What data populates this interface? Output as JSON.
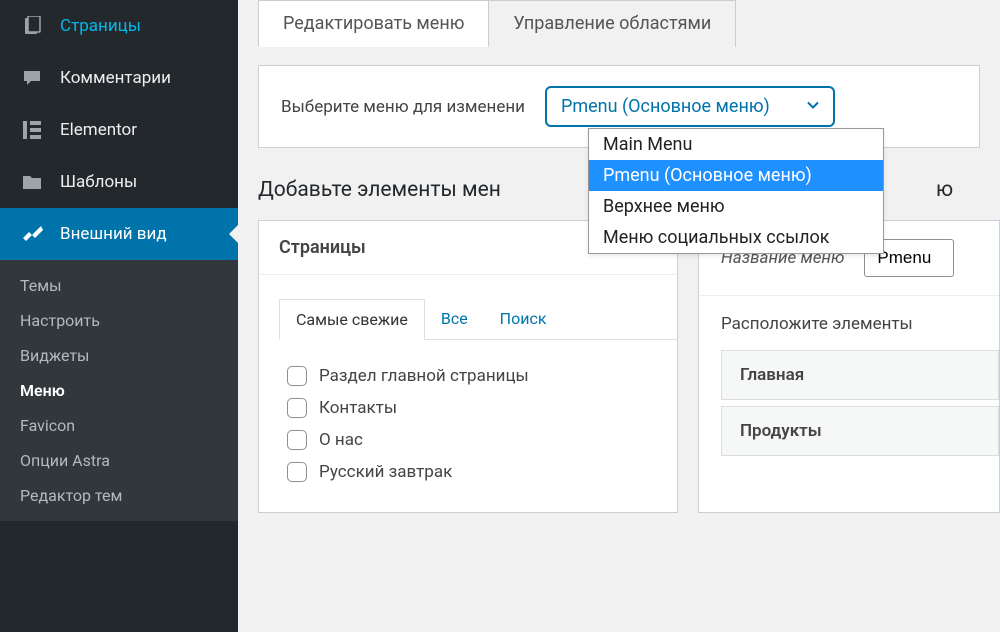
{
  "sidebar": {
    "items": [
      {
        "label": "Страницы",
        "icon": "pages"
      },
      {
        "label": "Комментарии",
        "icon": "comments"
      },
      {
        "label": "Elementor",
        "icon": "elementor"
      },
      {
        "label": "Шаблоны",
        "icon": "templates"
      },
      {
        "label": "Внешний вид",
        "icon": "appearance"
      }
    ],
    "submenu": [
      "Темы",
      "Настроить",
      "Виджеты",
      "Меню",
      "Favicon",
      "Опции Astra",
      "Редактор тем"
    ]
  },
  "tabs": {
    "edit": "Редактировать меню",
    "manage": "Управление областями"
  },
  "selector": {
    "label": "Выберите меню для изменени",
    "selected": "Pmenu (Основное меню)",
    "options": [
      "Main Menu",
      "Pmenu (Основное меню)",
      "Верхнее меню",
      "Меню социальных ссылок"
    ]
  },
  "add_heading": "Добавьте элементы мен",
  "structure_heading_tail": "ю",
  "pages_panel": {
    "title": "Страницы",
    "tabs": {
      "recent": "Самые свежие",
      "all": "Все",
      "search": "Поиск"
    },
    "items": [
      "Раздел главной страницы",
      "Контакты",
      "О нас",
      "Русский завтрак"
    ]
  },
  "menu_name": {
    "label": "Название меню",
    "value": "Pmenu"
  },
  "arrange_hint": "Расположите элементы",
  "menu_items": [
    "Главная",
    "Продукты"
  ]
}
